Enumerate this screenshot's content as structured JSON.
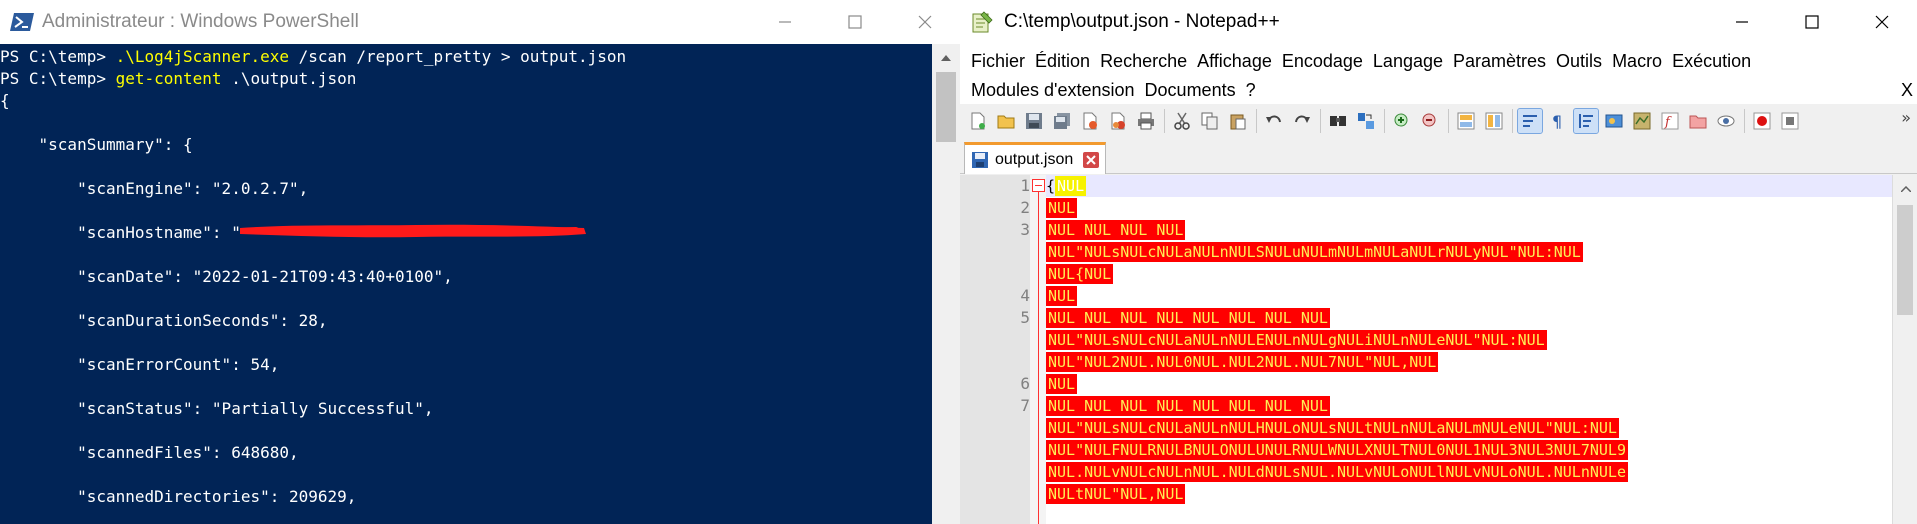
{
  "powershell": {
    "title": "Administrateur : Windows PowerShell",
    "console_lines": [
      {
        "prompt": "PS C:\\temp> ",
        "command": ".\\Log4jScanner.exe",
        "args": " /scan /report_pretty > output.json"
      },
      {
        "prompt": "PS C:\\temp> ",
        "command": "get-content",
        "args": " .\\output.json"
      },
      {
        "text": "{"
      },
      {
        "text": "    \"scanSummary\": {"
      },
      {
        "text": "        \"scanEngine\": \"2.0.2.7\","
      },
      {
        "text": "        \"scanHostname\": \""
      },
      {
        "text": "        \"scanDate\": \"2022-01-21T09:43:40+0100\","
      },
      {
        "text": "        \"scanDurationSeconds\": 28,"
      },
      {
        "text": "        \"scanErrorCount\": 54,"
      },
      {
        "text": "        \"scanStatus\": \"Partially Successful\","
      },
      {
        "text": "        \"scannedFiles\": 648680,"
      },
      {
        "text": "        \"scannedDirectories\": 209629,"
      }
    ]
  },
  "notepad": {
    "title": "C:\\temp\\output.json - Notepad++",
    "menu_row1": [
      "Fichier",
      "Édition",
      "Recherche",
      "Affichage",
      "Encodage",
      "Langage",
      "Paramètres",
      "Outils",
      "Macro",
      "Exécution"
    ],
    "menu_row2": [
      "Modules d'extension",
      "Documents",
      "?"
    ],
    "menu_close": "X",
    "tab_label": "output.json",
    "line_numbers": [
      "1",
      "2",
      "3",
      "4",
      "5",
      "6",
      "7"
    ],
    "code_lines": [
      "{NUL",
      "NUL",
      "NUL NUL NUL NUL",
      "NUL\"NULsNULcNULaNULnNULSNULuNULmNULmNULaNULrNULyNUL\"NUL:NUL",
      "NUL{NUL",
      "NUL",
      "NUL NUL NUL NUL NUL NUL NUL NUL",
      "NUL\"NULsNULcNULaNULnNULENULnNULgNULiNULnNULeNUL\"NUL:NUL",
      "NUL\"NUL2NUL.NUL0NUL.NUL2NUL.NUL7NUL\"NUL,NUL",
      "NUL",
      "NUL NUL NUL NUL NUL NUL NUL NUL",
      "NUL\"NULsNULcNULaNULnNULHNULoNULsNULtNULnNULaNULmNULeNUL\"NUL:NUL",
      "NUL\"NULFNULRNULBNULONULUNULRNULWNULXNULTNUL0NUL1NUL3NUL3NUL7NUL9",
      "NUL.NULvNULcNULnNUL.NULdNULsNUL.NULvNULoNULlNULvNULoNUL.NULnNULe",
      "NULtNUL\"NUL,NUL"
    ]
  },
  "colors": {
    "ps_background": "#012456",
    "ps_command": "#ffff00",
    "npp_nul_background": "#ff0000",
    "npp_nul_text": "#ffee55"
  }
}
